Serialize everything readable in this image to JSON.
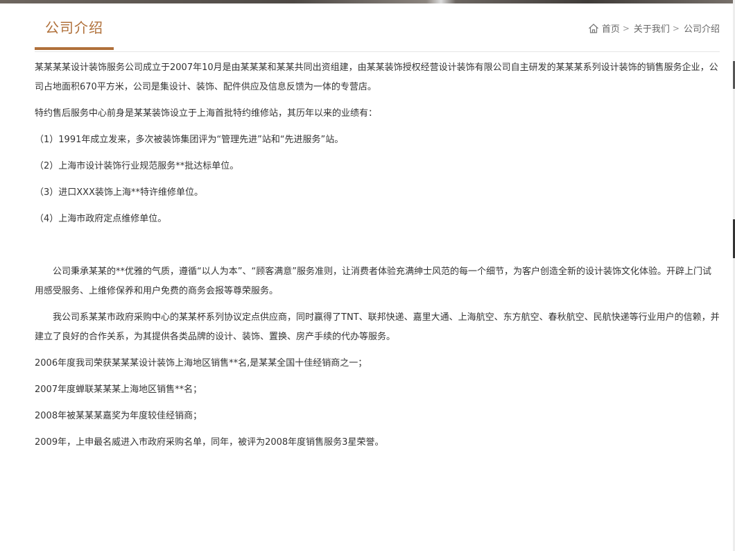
{
  "header": {
    "title": "公司介绍",
    "breadcrumb": [
      "首页",
      "关于我们",
      "公司介绍"
    ]
  },
  "paragraphs": {
    "p1": "某某某某设计装饰服务公司成立于2007年10月是由某某某和某某共同出资组建，由某某装饰授权经营设计装饰有限公司自主研发的某某某系列设计装饰的销售服务企业，公司占地面积670平方米，公司是集设计、装饰、配件供应及信息反馈为一体的专营店。",
    "p2": "特约售后服务中心前身是某某装饰设立于上海首批特约维修站，其历年以来的业绩有：",
    "p3": "（1）1991年成立发来，多次被装饰集团评为“管理先进”站和“先进服务”站。",
    "p4": "（2）上海市设计装饰行业规范服务**批达标单位。",
    "p5": "（3）进口XXX装饰上海**特许维修单位。",
    "p6": "（4）上海市政府定点维修单位。",
    "p7": "公司秉承某某的**优雅的气质，遵循“以人为本”、“顾客满意”服务准则，让消费者体验充满绅士风范的每一个细节，为客户创造全新的设计装饰文化体验。开辟上门试用感受服务、上维修保养和用户免费的商务会报等尊荣服务。",
    "p8": "我公司系某某市政府采购中心的某某杯系列协议定点供应商，同时赢得了TNT、联邦快递、嘉里大通、上海航空、东方航空、春秋航空、民航快递等行业用户的信赖，并建立了良好的合作关系，为其提供各类品牌的设计、装饰、置换、房产手续的代办等服务。",
    "p9": "2006年度我司荣获某某某设计装饰上海地区销售**名,是某某全国十佳经销商之一；",
    "p10": "2007年度蝉联某某某上海地区销售**名；",
    "p11": "2008年被某某某嘉奖为年度较佳经销商；",
    "p12": "2009年，上申最名威进入市政府采购名单，同年，被评为2008年度销售服务3星荣誉。"
  },
  "colors": {
    "accent": "#b0703a",
    "text": "#333333",
    "breadcrumb": "#666666",
    "divider": "#e6e6e6"
  },
  "icons": {
    "breadcrumb_home": "home-icon",
    "breadcrumb_separator": "chevron-right-icon"
  }
}
